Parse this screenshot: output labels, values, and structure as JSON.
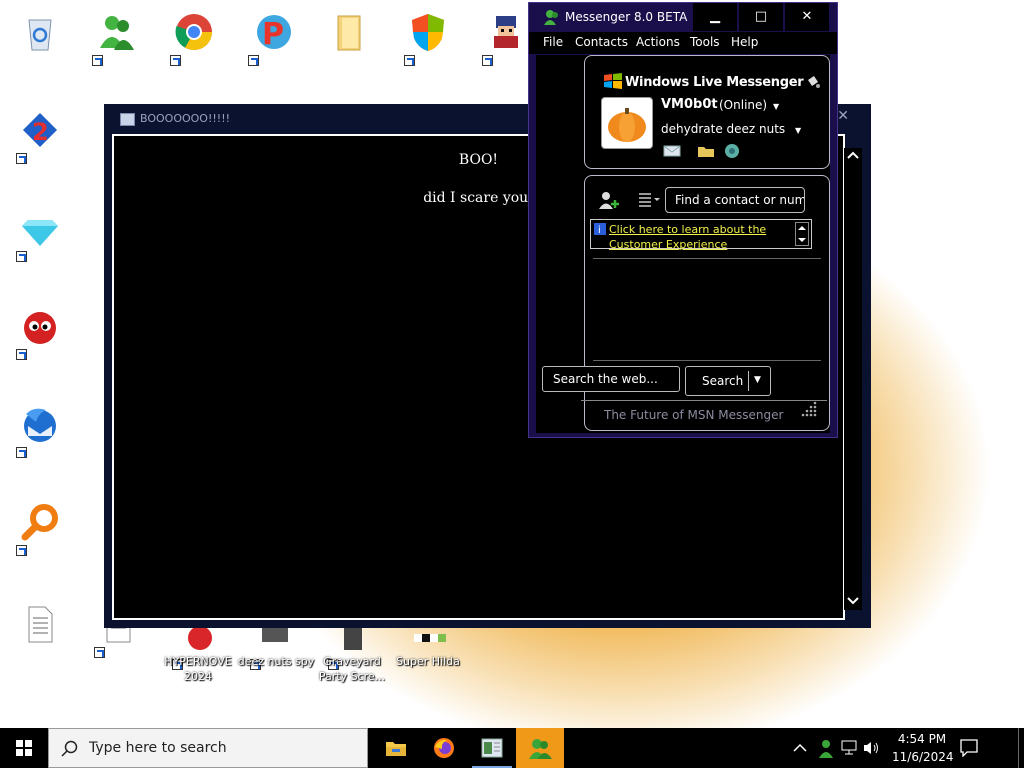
{
  "desktop": {
    "labels": {
      "item1": "HYPERNOVE\n2024",
      "item2": "deez nuts spy",
      "item3": "Graveyard\nParty Scre...",
      "item4": "Super Hilda"
    }
  },
  "boo_window": {
    "title": "BOOOOOOO!!!!!",
    "line1": "BOO!",
    "line2": "did I scare you!"
  },
  "messenger": {
    "title": "Messenger 8.0 BETA",
    "menu": [
      "File",
      "Contacts",
      "Actions",
      "Tools",
      "Help"
    ],
    "brand": "Windows Live Messenger",
    "user_name": "VM0b0t",
    "status": "(Online)",
    "personal_message": "dehydrate deez nuts",
    "find_placeholder": "Find a contact or number",
    "banner_text": "Click here to learn about the Customer Experience",
    "web_search_placeholder": "Search the web...",
    "search_button": "Search",
    "footer": "The Future of MSN Messenger"
  },
  "taskbar": {
    "search_placeholder": "Type here to search",
    "time": "4:54 PM",
    "date": "11/6/2024"
  },
  "colors": {
    "taskbar_active": "#f09818",
    "banner_link": "#f2f24a",
    "window_frame": "#0a1230"
  }
}
